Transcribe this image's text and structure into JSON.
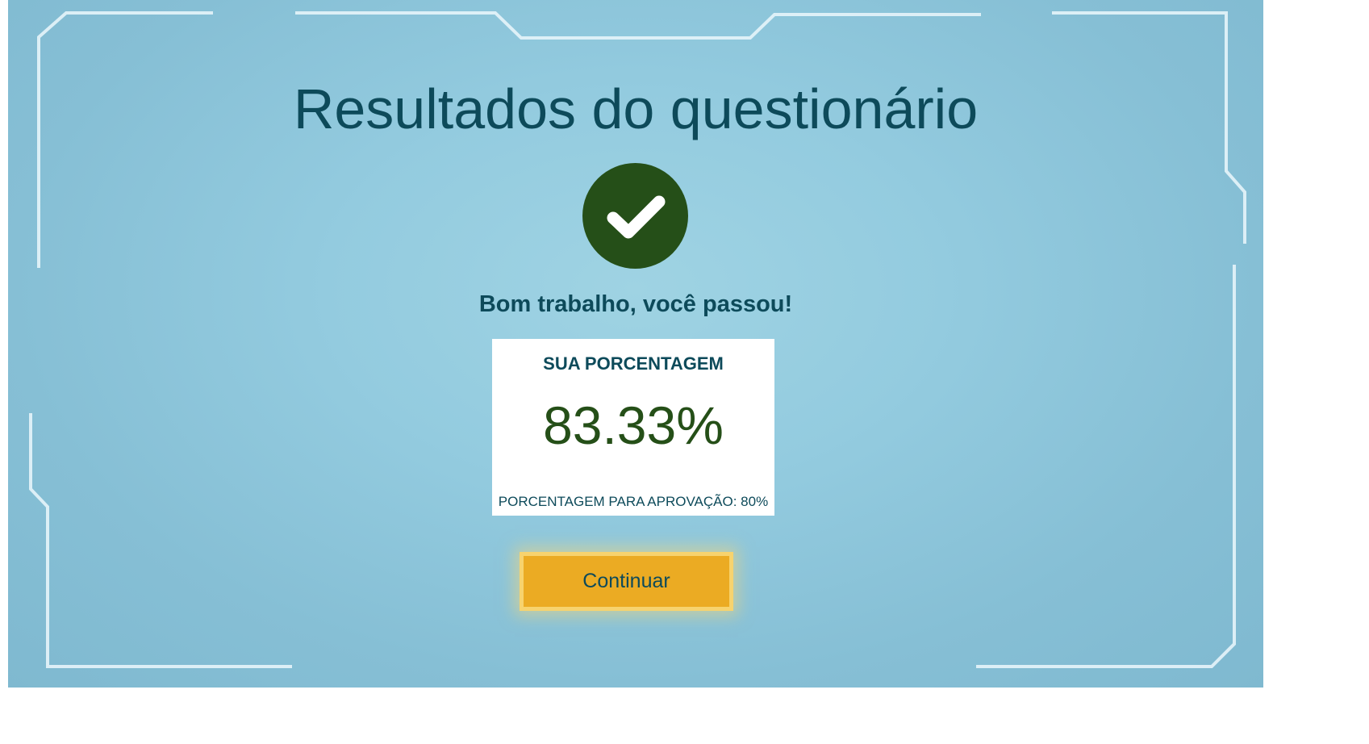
{
  "page": {
    "title": "Resultados do questionário",
    "message": "Bom trabalho, você passou!"
  },
  "result": {
    "status_icon": "checkmark-circle-icon",
    "heading": "SUA PORCENTAGEM",
    "score": "83.33%",
    "pass_threshold": "PORCENTAGEM PARA APROVAÇÃO: 80%"
  },
  "actions": {
    "continue_label": "Continuar"
  },
  "colors": {
    "background": "#93cbdf",
    "title_text": "#0d4a5a",
    "success_green": "#254f18",
    "button_fill": "#ebab23",
    "button_border": "#f7d36e",
    "frame_lines": "#e6f4fa"
  }
}
